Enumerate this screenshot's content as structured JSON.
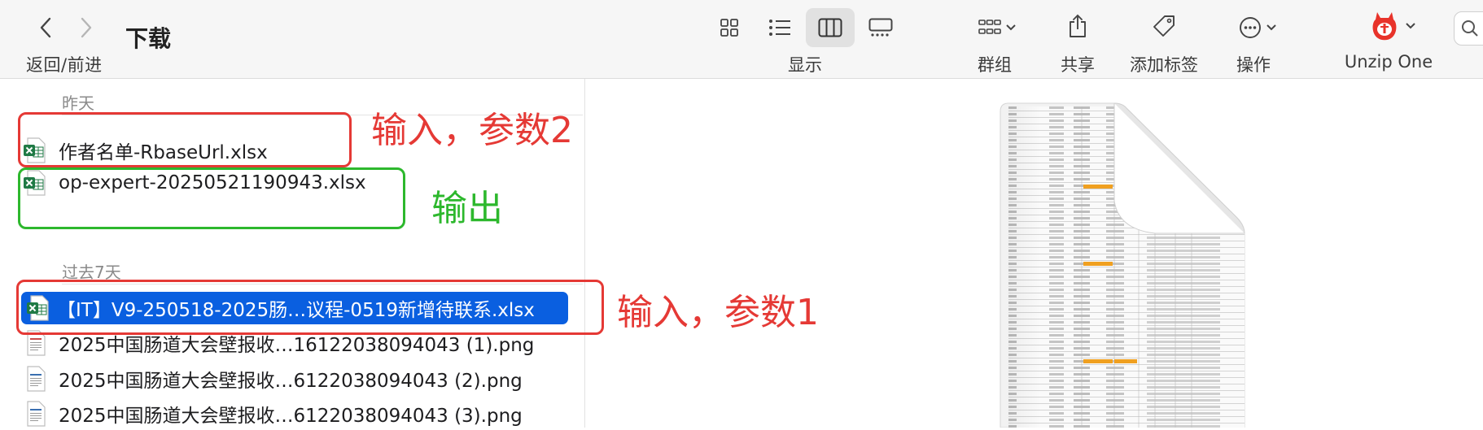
{
  "toolbar": {
    "title": "下载",
    "nav_label": "返回/前进",
    "view_label": "显示",
    "group_label": "群组",
    "share_label": "共享",
    "tag_label": "添加标签",
    "action_label": "操作",
    "unzip_label": "Unzip One"
  },
  "sections": [
    {
      "header": "昨天",
      "files": [
        {
          "name": "作者名单-RbaseUrl.xlsx",
          "type": "xlsx"
        },
        {
          "name": "op-expert-20250521190943.xlsx",
          "type": "xlsx"
        }
      ]
    },
    {
      "header": "过去7天",
      "files": [
        {
          "name": "【IT】V9-250518-2025肠…议程-0519新增待联系.xlsx",
          "type": "xlsx",
          "selected": true
        },
        {
          "name": "2025中国肠道大会壁报收…16122038094043 (1).png",
          "type": "png"
        },
        {
          "name": "2025中国肠道大会壁报收…6122038094043 (2).png",
          "type": "png"
        },
        {
          "name": "2025中国肠道大会壁报收…6122038094043 (3).png",
          "type": "png"
        }
      ]
    }
  ],
  "annotations": {
    "input2": "输入，参数2",
    "output": "输出",
    "input1": "输入，参数1"
  },
  "colors": {
    "selection": "#0a5fe0",
    "annotation_red": "#e53935",
    "annotation_green": "#2db82d",
    "excel_green": "#1f7a45"
  }
}
